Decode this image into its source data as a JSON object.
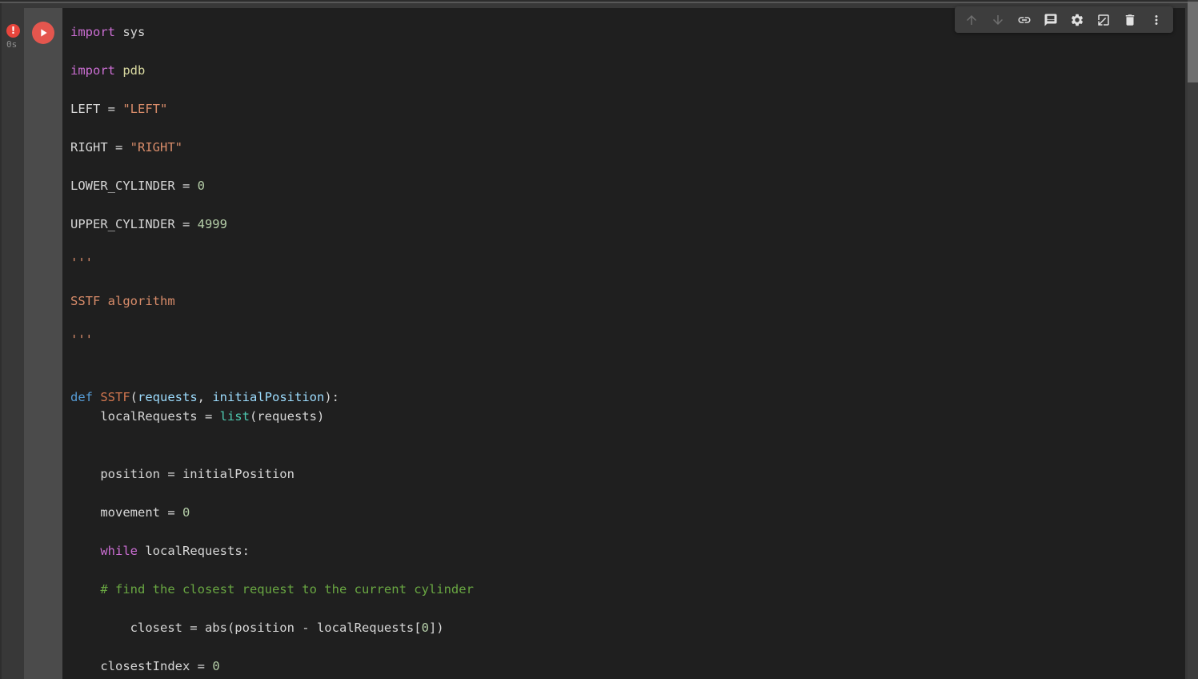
{
  "app": "colab-code-cell",
  "colors": {
    "page_bg": "#383838",
    "code_bg": "#1f1f1f",
    "gutter_bg": "#4b4b4b",
    "toolbar_bg": "#3d3d3d",
    "run_button": "#e4564e",
    "error_badge": "#e8453c",
    "scroll_thumb": "#6f6f6f"
  },
  "cell": {
    "execution": {
      "state": "error",
      "badge_glyph": "!",
      "elapsed_label": "0s",
      "run_icon": "play-icon"
    },
    "toolbar": [
      {
        "icon": "arrow-up-icon",
        "name": "move-cell-up",
        "disabled": true
      },
      {
        "icon": "arrow-down-icon",
        "name": "move-cell-down",
        "disabled": true
      },
      {
        "icon": "link-icon",
        "name": "copy-link-to-cell",
        "disabled": false
      },
      {
        "icon": "comment-icon",
        "name": "add-comment",
        "disabled": false
      },
      {
        "icon": "gear-icon",
        "name": "open-editor-settings",
        "disabled": false
      },
      {
        "icon": "mirror-cell-icon",
        "name": "mirror-cell-in-tab",
        "disabled": false
      },
      {
        "icon": "trash-icon",
        "name": "delete-cell",
        "disabled": false
      },
      {
        "icon": "more-vert-icon",
        "name": "more-cell-actions",
        "disabled": false
      }
    ]
  },
  "code": {
    "language": "python",
    "syntax_colors": {
      "pl": "#d6d6d6",
      "kw": "#cb6ed3",
      "kw2": "#569cd6",
      "str": "#d88c6a",
      "num": "#b5cea8",
      "fn": "#d1764f",
      "param": "#9cdcfe",
      "builtin": "#4ec9b0",
      "com": "#69a742",
      "mod": "#d8d8a0"
    },
    "lines": [
      [
        [
          "kw",
          "import"
        ],
        [
          "pl",
          " sys"
        ]
      ],
      [],
      [
        [
          "kw",
          "import"
        ],
        [
          "pl",
          " "
        ],
        [
          "mod",
          "pdb"
        ]
      ],
      [],
      [
        [
          "pl",
          "LEFT = "
        ],
        [
          "str",
          "\"LEFT\""
        ]
      ],
      [],
      [
        [
          "pl",
          "RIGHT = "
        ],
        [
          "str",
          "\"RIGHT\""
        ]
      ],
      [],
      [
        [
          "pl",
          "LOWER_CYLINDER = "
        ],
        [
          "num",
          "0"
        ]
      ],
      [],
      [
        [
          "pl",
          "UPPER_CYLINDER = "
        ],
        [
          "num",
          "4999"
        ]
      ],
      [],
      [
        [
          "str",
          "'''"
        ]
      ],
      [],
      [
        [
          "str",
          "SSTF algorithm"
        ]
      ],
      [],
      [
        [
          "str",
          "'''"
        ]
      ],
      [],
      [],
      [
        [
          "kw2",
          "def"
        ],
        [
          "pl",
          " "
        ],
        [
          "fn",
          "SSTF"
        ],
        [
          "pl",
          "("
        ],
        [
          "param",
          "requests"
        ],
        [
          "pl",
          ", "
        ],
        [
          "param",
          "initialPosition"
        ],
        [
          "pl",
          "):"
        ]
      ],
      [
        [
          "pl",
          "    localRequests = "
        ],
        [
          "builtin",
          "list"
        ],
        [
          "pl",
          "(requests)"
        ]
      ],
      [],
      [],
      [
        [
          "pl",
          "    position = initialPosition"
        ]
      ],
      [],
      [
        [
          "pl",
          "    movement = "
        ],
        [
          "num",
          "0"
        ]
      ],
      [],
      [
        [
          "pl",
          "    "
        ],
        [
          "kw",
          "while"
        ],
        [
          "pl",
          " localRequests:"
        ]
      ],
      [],
      [
        [
          "pl",
          "    "
        ],
        [
          "com",
          "# find the closest request to the current cylinder"
        ]
      ],
      [],
      [
        [
          "pl",
          "        closest = abs(position - localRequests["
        ],
        [
          "num",
          "0"
        ],
        [
          "pl",
          "])"
        ]
      ],
      [],
      [
        [
          "pl",
          "    closestIndex = "
        ],
        [
          "num",
          "0"
        ]
      ]
    ]
  }
}
